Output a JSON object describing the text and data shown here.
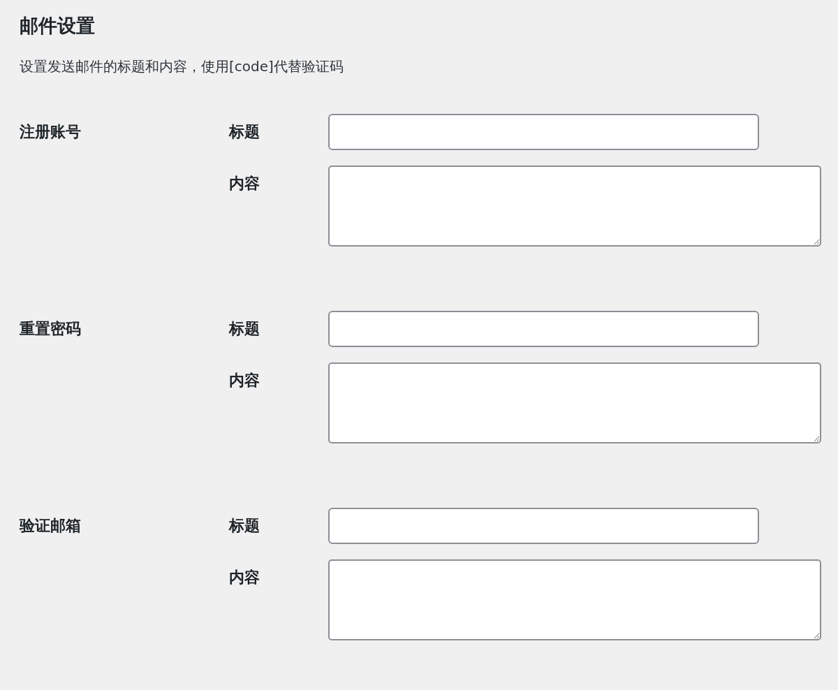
{
  "title": "邮件设置",
  "description": "设置发送邮件的标题和内容，使用[code]代替验证码",
  "sections": [
    {
      "label": "注册账号",
      "fields": [
        {
          "kind": "input",
          "label": "标题"
        },
        {
          "kind": "textarea",
          "label": "内容"
        }
      ]
    },
    {
      "label": "重置密码",
      "fields": [
        {
          "kind": "input",
          "label": "标题"
        },
        {
          "kind": "textarea",
          "label": "内容"
        }
      ]
    },
    {
      "label": "验证邮箱",
      "fields": [
        {
          "kind": "input",
          "label": "标题"
        },
        {
          "kind": "textarea",
          "label": "内容"
        }
      ]
    }
  ]
}
